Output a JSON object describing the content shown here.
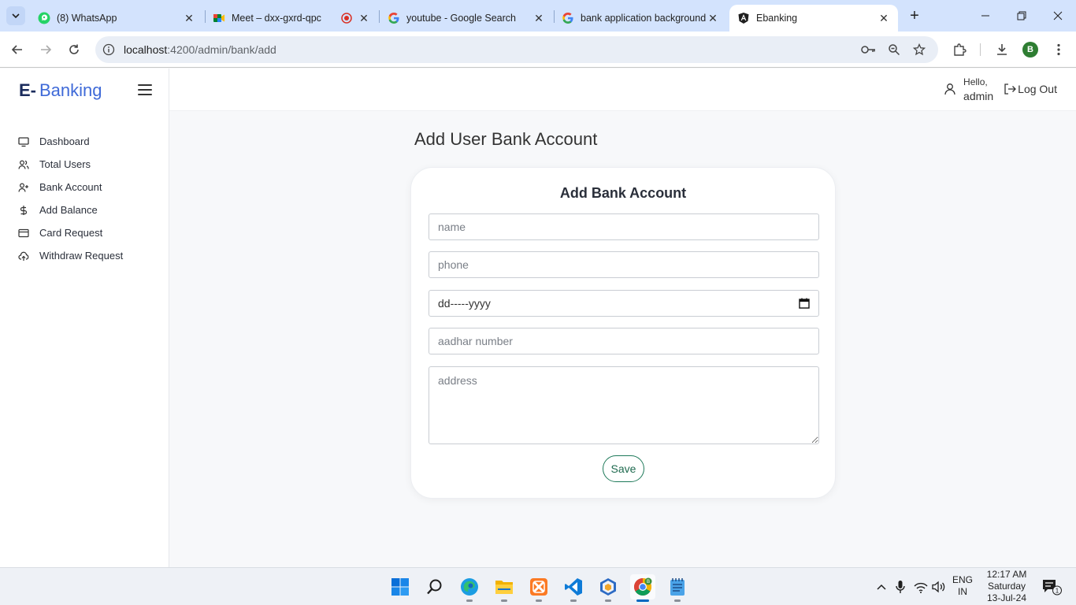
{
  "browser": {
    "tabs": [
      {
        "title": "(8) WhatsApp",
        "icon": "whatsapp-icon"
      },
      {
        "title": "Meet – dxx-gxrd-qpc",
        "icon": "google-meet-icon"
      },
      {
        "title": "youtube - Google Search",
        "icon": "google-icon"
      },
      {
        "title": "bank application background",
        "icon": "google-icon"
      },
      {
        "title": "Ebanking",
        "icon": "angular-icon",
        "active": true
      }
    ],
    "url_host": "localhost",
    "url_path": ":4200/admin/bank/add",
    "profile_initial": "B"
  },
  "app": {
    "brand_prefix": "E-",
    "brand_name": "Banking",
    "menu": [
      {
        "label": "Dashboard",
        "icon": "monitor-icon"
      },
      {
        "label": "Total Users",
        "icon": "users-icon"
      },
      {
        "label": "Bank Account",
        "icon": "user-plus-icon"
      },
      {
        "label": "Add Balance",
        "icon": "dollar-icon"
      },
      {
        "label": "Card Request",
        "icon": "credit-card-icon"
      },
      {
        "label": "Withdraw Request",
        "icon": "cloud-upload-icon"
      }
    ],
    "greeting": "Hello,",
    "username": "admin",
    "logout_label": "Log Out"
  },
  "page": {
    "title": "Add User Bank Account",
    "card_title": "Add Bank Account",
    "fields": {
      "name_placeholder": "name",
      "phone_placeholder": "phone",
      "dob_placeholder": "dd-----yyyy",
      "aadhar_placeholder": "aadhar number",
      "address_placeholder": "address"
    },
    "save_label": "Save"
  },
  "taskbar": {
    "apps": [
      "windows-start-icon",
      "search-icon",
      "edge-icon",
      "file-explorer-icon",
      "xampp-icon",
      "vscode-icon",
      "virtualbox-icon",
      "chrome-icon",
      "notepad-icon"
    ],
    "lang_1": "ENG",
    "lang_2": "IN",
    "time": "12:17 AM",
    "day": "Saturday",
    "date": "13-Jul-24",
    "notification_count": "1"
  },
  "colors": {
    "accent": "#3f6ad8",
    "save_border": "#1f7a5a",
    "tab_strip": "#d3e3fd"
  }
}
